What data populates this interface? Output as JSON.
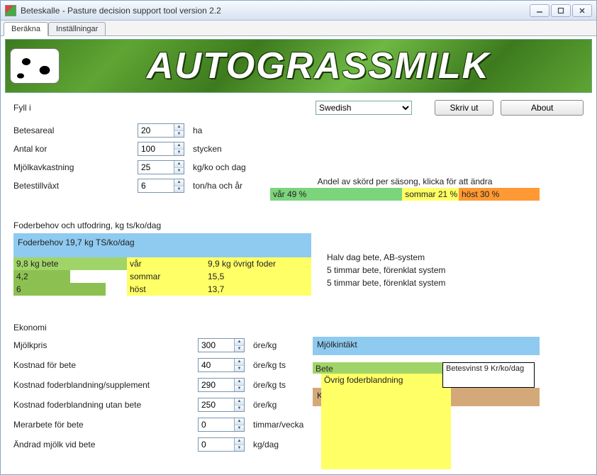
{
  "window": {
    "title": "Beteskalle - Pasture decision support tool version 2.2"
  },
  "tabs": {
    "calc": "Beräkna",
    "settings": "Inställningar"
  },
  "banner": {
    "text": "AUTOGRASSMILK"
  },
  "header": {
    "fill_in": "Fyll i",
    "language_selected": "Swedish",
    "print": "Skriv ut",
    "about": "About"
  },
  "inputs": {
    "area": {
      "label": "Betesareal",
      "value": "20",
      "unit": "ha"
    },
    "cows": {
      "label": "Antal kor",
      "value": "100",
      "unit": "stycken"
    },
    "yield": {
      "label": "Mjölkavkastning",
      "value": "25",
      "unit": "kg/ko och dag"
    },
    "growth": {
      "label": "Betestillväxt",
      "value": "6",
      "unit": "ton/ha och år"
    }
  },
  "season": {
    "title": "Andel av skörd per säsong, klicka för att ändra",
    "spring": {
      "label": "vår 49 %",
      "pct": 49
    },
    "summer": {
      "label": "sommar 21 %",
      "pct": 21
    },
    "autumn": {
      "label": "höst 30 %",
      "pct": 30
    }
  },
  "feed": {
    "section": "Foderbehov och utfodring, kg ts/ko/dag",
    "header": "Foderbehov 19,7 kg TS/ko/dag",
    "rows": [
      {
        "bete": "9,8 kg bete",
        "season": "vår",
        "other": "9,9 kg övrigt foder",
        "note": "Halv dag bete, AB-system"
      },
      {
        "bete": "4,2",
        "season": "sommar",
        "other": "15,5",
        "note": "5 timmar bete, förenklat system"
      },
      {
        "bete": "6",
        "season": "höst",
        "other": "13,7",
        "note": "5 timmar bete, förenklat system"
      }
    ]
  },
  "economy": {
    "section": "Ekonomi",
    "milk_price": {
      "label": "Mjölkpris",
      "value": "300",
      "unit": "öre/kg"
    },
    "cost_pasture": {
      "label": "Kostnad för bete",
      "value": "40",
      "unit": "öre/kg ts"
    },
    "cost_mix": {
      "label": "Kostnad foderblandning/supplement",
      "value": "290",
      "unit": "öre/kg ts"
    },
    "cost_mix_no": {
      "label": "Kostnad foderblandning utan bete",
      "value": "250",
      "unit": "öre/kg"
    },
    "extra_work": {
      "label": "Merarbete för bete",
      "value": "0",
      "unit": "timmar/vecka"
    },
    "milk_change": {
      "label": "Ändrad mjölk vid bete",
      "value": "0",
      "unit": "kg/dag"
    }
  },
  "econ_chart": {
    "milk": "Mjölkintäkt",
    "bete": "Bete",
    "ovrig": "Övrig foderblandning",
    "vinst": "Betesvinst 9 Kr/ko/dag",
    "utan": "Kostnad utan bete"
  }
}
